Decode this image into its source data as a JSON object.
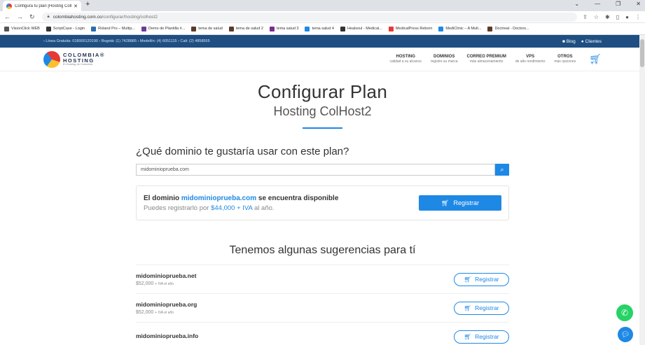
{
  "browser": {
    "tab_title": "Configura tu plan [Hosting ColH...",
    "url_domain": "colombiahosting.com.co",
    "url_path": "/configurar/hosting/colhost2",
    "bookmarks": [
      {
        "label": "VisionClick WEB",
        "color": "#555"
      },
      {
        "label": "ScriptCase - Login",
        "color": "#333"
      },
      {
        "label": "Roland Pro – Multip...",
        "color": "#2b6cb0"
      },
      {
        "label": "Demo de Plantilla #...",
        "color": "#6a3d9a"
      },
      {
        "label": "tema de salud",
        "color": "#5b3a29"
      },
      {
        "label": "tema de salud 2",
        "color": "#5b3a29"
      },
      {
        "label": "tema salud 3",
        "color": "#7b2d8e"
      },
      {
        "label": "tema salud 4",
        "color": "#1e88e5"
      },
      {
        "label": "Healsoul - Medical...",
        "color": "#333"
      },
      {
        "label": "MedicalPress Reborn",
        "color": "#e53935"
      },
      {
        "label": "MediClinic – A Mult...",
        "color": "#1e88e5"
      },
      {
        "label": "Doctreat - Doctors...",
        "color": "#5b3a29"
      }
    ]
  },
  "topbar": {
    "info": "› Línea Gratuita: 018000120190  › Bogotá: (1) 7428885  › Medellín: (4) 6051115  › Cali: (2) 4858555",
    "blog": "Blog",
    "clientes": "Clientes"
  },
  "logo": {
    "line1": "COLOMBIA®",
    "line2": "HOSTING",
    "tagline": "El Hosting de Colombia"
  },
  "menu": [
    {
      "title": "HOSTING",
      "sub": "calidad a su alcance"
    },
    {
      "title": "DOMINIOS",
      "sub": "registre su marca"
    },
    {
      "title": "CORREO PREMIUM",
      "sub": "más almacenamiento"
    },
    {
      "title": "VPS",
      "sub": "de alto rendimiento"
    },
    {
      "title": "OTROS",
      "sub": "más opciones"
    }
  ],
  "cart_count": "0",
  "page": {
    "title": "Configurar Plan",
    "subtitle": "Hosting ColHost2",
    "question": "¿Qué dominio te gustaría usar con este plan?",
    "search_value": "midominioprueba.com"
  },
  "availability": {
    "prefix": "El dominio ",
    "domain": "midominioprueba.com",
    "suffix": " se encuentra disponible",
    "price_prefix": "Puedes registrarlo por ",
    "price": "$44,000 + IVA",
    "price_suffix": " al año.",
    "button": "Registrar"
  },
  "suggestions": {
    "title": "Tenemos algunas sugerencias para tí",
    "items": [
      {
        "name": "midominioprueba.net",
        "price": "$52,000",
        "tax": "+ IVA el año",
        "button": "Registrar"
      },
      {
        "name": "midominioprueba.org",
        "price": "$52,000",
        "tax": "+ IVA el año",
        "button": "Registrar"
      },
      {
        "name": "midominioprueba.info",
        "price": "",
        "tax": "",
        "button": "Registrar"
      }
    ]
  }
}
